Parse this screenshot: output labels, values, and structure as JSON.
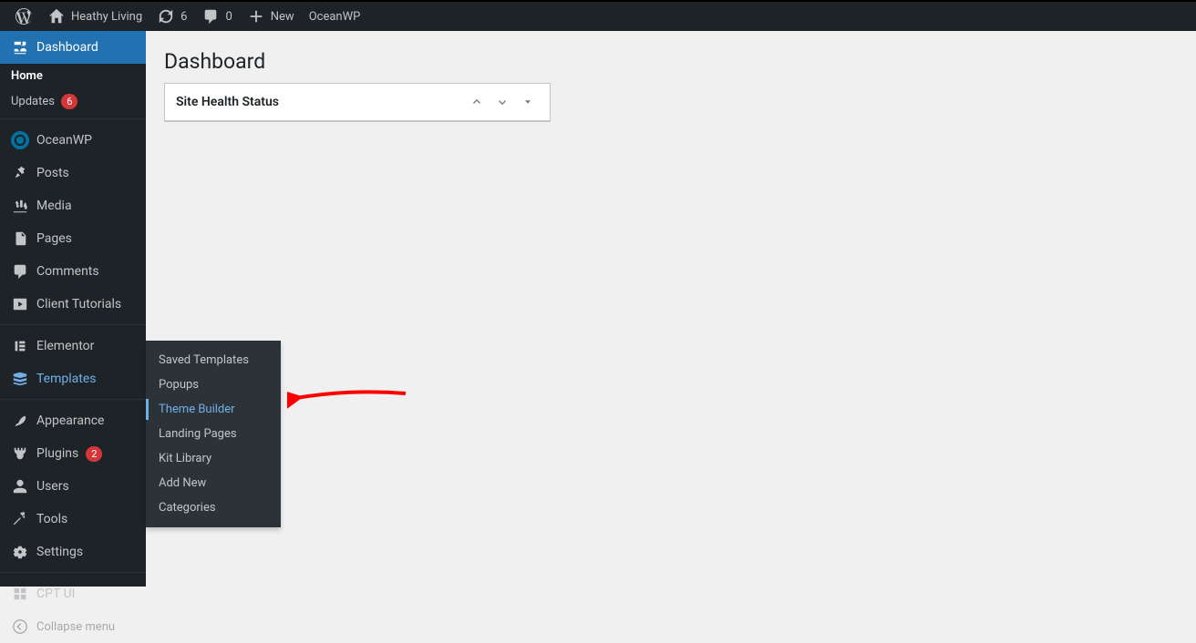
{
  "topbar": {
    "site_name": "Heathy Living",
    "updates_count": "6",
    "comments_count": "0",
    "new_label": "New",
    "ocean_label": "OceanWP"
  },
  "sidebar": {
    "dashboard": "Dashboard",
    "home": "Home",
    "updates": "Updates",
    "updates_badge": "6",
    "oceanwp": "OceanWP",
    "posts": "Posts",
    "media": "Media",
    "pages": "Pages",
    "comments": "Comments",
    "client_tutorials": "Client Tutorials",
    "elementor": "Elementor",
    "templates": "Templates",
    "appearance": "Appearance",
    "plugins": "Plugins",
    "plugins_badge": "2",
    "users": "Users",
    "tools": "Tools",
    "settings": "Settings",
    "cpt_ui": "CPT UI",
    "collapse": "Collapse menu"
  },
  "flyout": {
    "saved_templates": "Saved Templates",
    "popups": "Popups",
    "theme_builder": "Theme Builder",
    "landing_pages": "Landing Pages",
    "kit_library": "Kit Library",
    "add_new": "Add New",
    "categories": "Categories"
  },
  "main": {
    "title": "Dashboard",
    "widget_title": "Site Health Status"
  }
}
